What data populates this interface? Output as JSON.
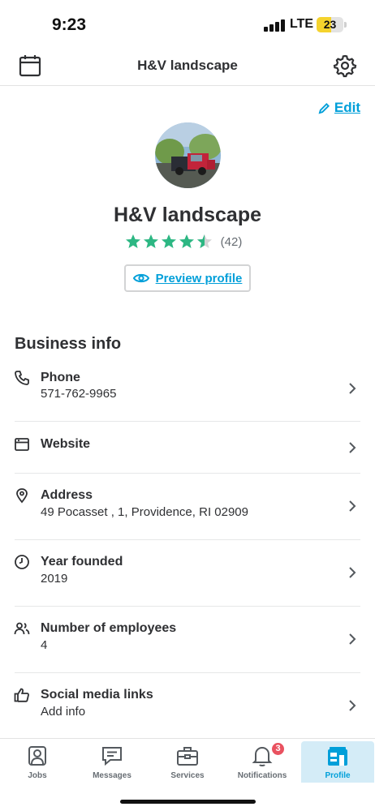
{
  "status_bar": {
    "time": "9:23",
    "network": "LTE",
    "battery": "23",
    "battery_level": 0.23
  },
  "header": {
    "title": "H&V landscape",
    "left_icon": "calendar-icon",
    "right_icon": "gear-icon"
  },
  "profile": {
    "edit_label": "Edit",
    "name": "H&V landscape",
    "rating": 4.5,
    "review_count": "(42)",
    "preview_label": "Preview profile"
  },
  "business_info": {
    "title": "Business info",
    "rows": [
      {
        "icon": "phone-icon",
        "label": "Phone",
        "value": "571-762-9965"
      },
      {
        "icon": "browser-window-icon",
        "label": "Website",
        "value": ""
      },
      {
        "icon": "location-pin-icon",
        "label": "Address",
        "value": "49 Pocasset , 1, Providence, RI 02909"
      },
      {
        "icon": "clock-icon",
        "label": "Year founded",
        "value": "2019"
      },
      {
        "icon": "people-icon",
        "label": "Number of employees",
        "value": "4"
      },
      {
        "icon": "thumbs-up-icon",
        "label": "Social media links",
        "value": "Add info"
      }
    ]
  },
  "tabs": [
    {
      "icon": "person-icon",
      "label": "Jobs",
      "active": false
    },
    {
      "icon": "message-icon",
      "label": "Messages",
      "active": false
    },
    {
      "icon": "toolbox-icon",
      "label": "Services",
      "active": false
    },
    {
      "icon": "bell-icon",
      "label": "Notifications",
      "active": false,
      "badge": "3"
    },
    {
      "icon": "storefront-icon",
      "label": "Profile",
      "active": true
    }
  ],
  "colors": {
    "accent": "#009fd9",
    "star": "#2db783",
    "badge": "#e9515f",
    "text": "#2f3033"
  }
}
